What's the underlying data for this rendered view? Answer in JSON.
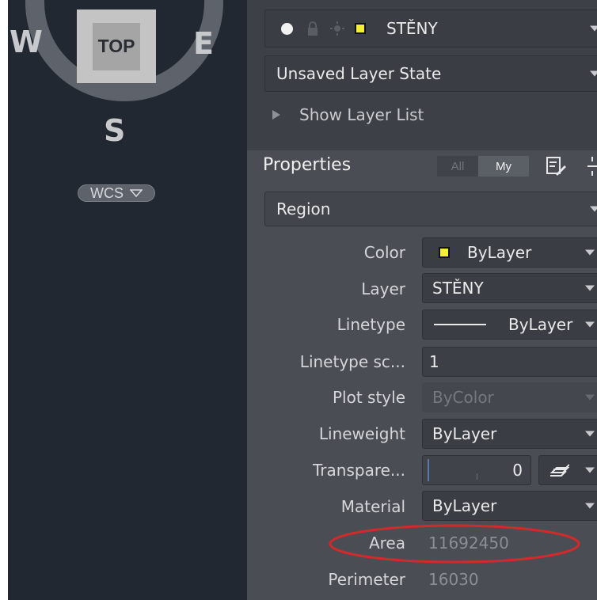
{
  "compass": {
    "west": "W",
    "east": "E",
    "south": "S",
    "view_cube_face": "TOP",
    "ucs_label": "WCS"
  },
  "layers": {
    "current_layer": "STĚNY",
    "layer_state": "Unsaved Layer State",
    "show_layer_list": "Show Layer List"
  },
  "properties": {
    "title": "Properties",
    "filter_all": "All",
    "filter_my": "My",
    "object_type": "Region",
    "rows": {
      "color": {
        "label": "Color",
        "value": "ByLayer"
      },
      "layer": {
        "label": "Layer",
        "value": "STĚNY"
      },
      "linetype": {
        "label": "Linetype",
        "value": "ByLayer"
      },
      "linetype_scale": {
        "label": "Linetype sc...",
        "value": "1"
      },
      "plot_style": {
        "label": "Plot style",
        "value": "ByColor"
      },
      "lineweight": {
        "label": "Lineweight",
        "value": "ByLayer"
      },
      "transparency": {
        "label": "Transpare...",
        "value": "0"
      },
      "material": {
        "label": "Material",
        "value": "ByLayer"
      },
      "area": {
        "label": "Area",
        "value": "11692450"
      },
      "perimeter": {
        "label": "Perimeter",
        "value": "16030"
      }
    }
  },
  "colors": {
    "swatch_yellow": "#f3ef31",
    "annotation_red": "#d22a2a",
    "panel_bg": "#4a4e54",
    "viewport_bg": "#222831"
  },
  "icons": [
    "bulb-icon",
    "lock-icon",
    "sun-icon",
    "edit-icon",
    "expand-icon",
    "layers-icon",
    "chevron-right-icon",
    "chevron-down-icon"
  ]
}
